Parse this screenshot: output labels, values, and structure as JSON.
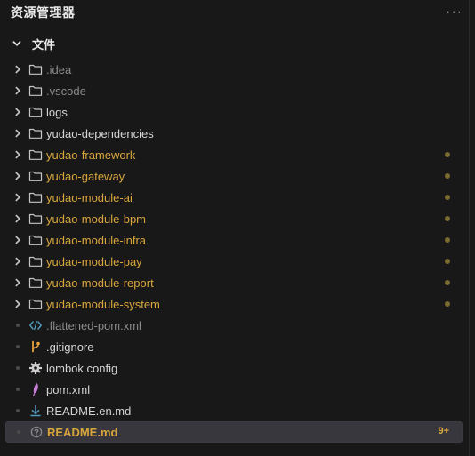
{
  "header": {
    "title": "资源管理器",
    "more_label": "···"
  },
  "section": {
    "label": "文件"
  },
  "colors": {
    "background": "#181818",
    "selected_row": "#37373d",
    "modified_text": "#d7a73d",
    "modified_dot": "#7a6a2e",
    "ignored_text": "#8b8b8b",
    "folder_icon": "#c5c5c5"
  },
  "tree": {
    "items": [
      {
        "label": ".idea",
        "kind": "folder",
        "icon": "folder-icon",
        "state": "ignored"
      },
      {
        "label": ".vscode",
        "kind": "folder",
        "icon": "folder-icon",
        "state": "ignored"
      },
      {
        "label": "logs",
        "kind": "folder",
        "icon": "folder-icon",
        "state": "normal"
      },
      {
        "label": "yudao-dependencies",
        "kind": "folder",
        "icon": "folder-icon",
        "state": "normal"
      },
      {
        "label": "yudao-framework",
        "kind": "folder",
        "icon": "folder-icon",
        "state": "modified"
      },
      {
        "label": "yudao-gateway",
        "kind": "folder",
        "icon": "folder-icon",
        "state": "modified"
      },
      {
        "label": "yudao-module-ai",
        "kind": "folder",
        "icon": "folder-icon",
        "state": "modified"
      },
      {
        "label": "yudao-module-bpm",
        "kind": "folder",
        "icon": "folder-icon",
        "state": "modified"
      },
      {
        "label": "yudao-module-infra",
        "kind": "folder",
        "icon": "folder-icon",
        "state": "modified"
      },
      {
        "label": "yudao-module-pay",
        "kind": "folder",
        "icon": "folder-icon",
        "state": "modified"
      },
      {
        "label": "yudao-module-report",
        "kind": "folder",
        "icon": "folder-icon",
        "state": "modified"
      },
      {
        "label": "yudao-module-system",
        "kind": "folder",
        "icon": "folder-icon",
        "state": "modified"
      },
      {
        "label": ".flattened-pom.xml",
        "kind": "file",
        "icon": "xml-code-icon",
        "state": "ignored"
      },
      {
        "label": ".gitignore",
        "kind": "file",
        "icon": "git-branch-icon",
        "state": "normal"
      },
      {
        "label": "lombok.config",
        "kind": "file",
        "icon": "gear-icon",
        "state": "normal"
      },
      {
        "label": "pom.xml",
        "kind": "file",
        "icon": "maven-feather-icon",
        "state": "normal"
      },
      {
        "label": "README.en.md",
        "kind": "file",
        "icon": "markdown-download-icon",
        "state": "normal"
      },
      {
        "label": "README.md",
        "kind": "file",
        "icon": "question-circle-icon",
        "state": "selected-modified",
        "badge": "9+"
      }
    ]
  }
}
